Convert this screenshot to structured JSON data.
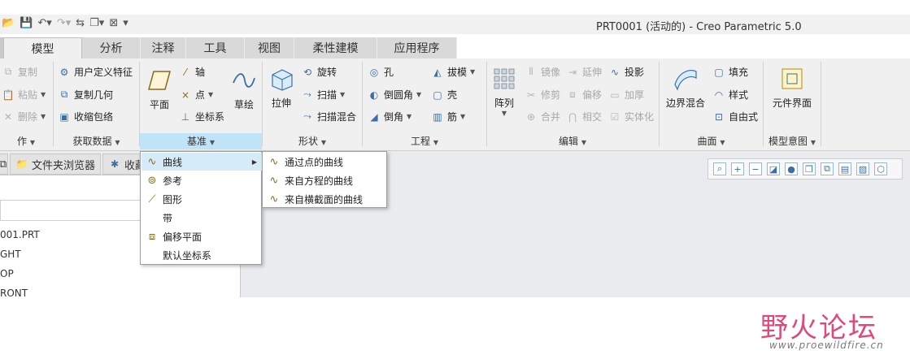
{
  "window": {
    "title": "PRT0001 (活动的) - Creo Parametric 5.0"
  },
  "tabs": [
    "模型",
    "分析",
    "注释",
    "工具",
    "视图",
    "柔性建模",
    "应用程序"
  ],
  "ribbon": {
    "operations": {
      "items": [
        "复制",
        "粘贴",
        "删除"
      ],
      "label": "作"
    },
    "get_data": {
      "items": [
        "用户定义特征",
        "复制几何",
        "收缩包络"
      ],
      "label": "获取数据"
    },
    "datum": {
      "plane": "平面",
      "axis": "轴",
      "point": "点",
      "csys": "坐标系",
      "sketch": "草绘",
      "label": "基准"
    },
    "shapes": {
      "extrude": "拉伸",
      "revolve": "旋转",
      "sweep": "扫描",
      "swept_blend": "扫描混合",
      "label": "形状"
    },
    "engineering": {
      "hole": "孔",
      "round": "倒圆角",
      "chamfer": "倒角",
      "draft": "拔模",
      "shell": "壳",
      "rib": "筋",
      "label": "工程"
    },
    "editing": {
      "pattern": "阵列",
      "mirror": "镜像",
      "extend": "延伸",
      "project": "投影",
      "trim": "修剪",
      "offset": "偏移",
      "thicken": "加厚",
      "merge": "合并",
      "intersect": "相交",
      "solidify": "实体化",
      "label": "编辑"
    },
    "surfaces": {
      "boundary_blend": "边界混合",
      "fill": "填充",
      "style": "样式",
      "freestyle": "自由式",
      "label": "曲面"
    },
    "model_intent": {
      "component_interface": "元件界面",
      "label": "模型意图"
    }
  },
  "left_panel": {
    "tabs": [
      "文件夹浏览器",
      "收藏"
    ],
    "tree": [
      "001.PRT",
      "GHT",
      "OP",
      "RONT"
    ]
  },
  "datum_menu": {
    "items": [
      "曲线",
      "参考",
      "图形",
      "带",
      "偏移平面",
      "默认坐标系"
    ]
  },
  "curve_submenu": {
    "items": [
      "通过点的曲线",
      "来自方程的曲线",
      "来自横截面的曲线"
    ]
  },
  "watermark": {
    "cn": "野火论坛",
    "url": "www.proewildfire.cn"
  }
}
